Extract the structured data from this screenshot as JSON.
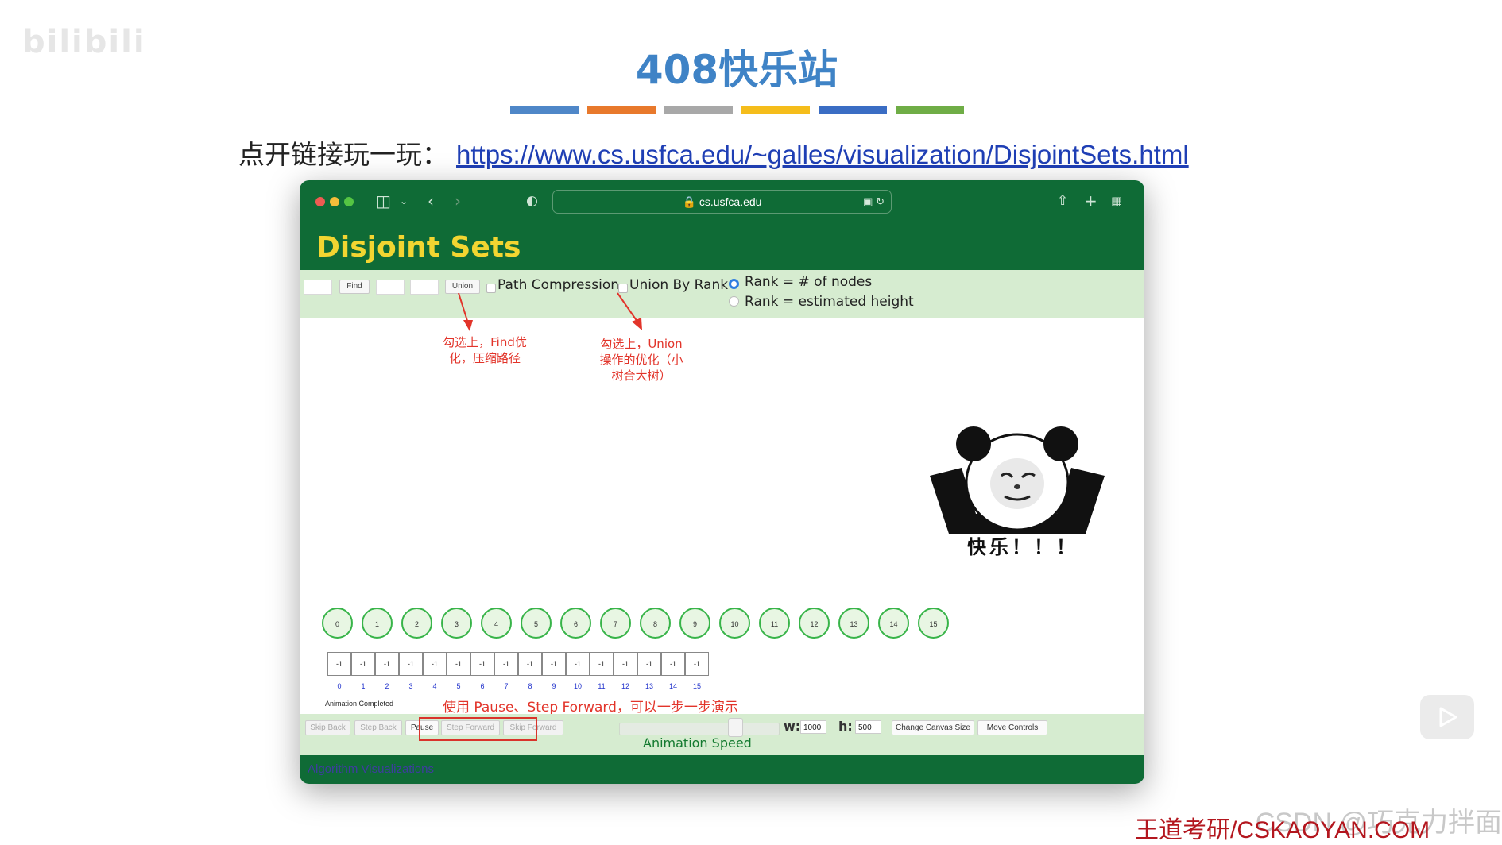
{
  "watermark": "bilibili",
  "slide": {
    "title": "408快乐站",
    "color_bars": [
      "#4f87c8",
      "#e8792c",
      "#a8a8a8",
      "#f5bd1b",
      "#3a6dc4",
      "#6fad46"
    ],
    "link_label": "点开链接玩一玩：",
    "link_url": "https://www.cs.usfca.edu/~galles/visualization/DisjointSets.html"
  },
  "browser": {
    "address": "cs.usfca.edu",
    "icons": [
      "sidebar-icon",
      "back-icon",
      "forward-icon",
      "shield-icon",
      "lock-icon",
      "translate-icon",
      "reload-icon",
      "share-icon",
      "new-tab-icon",
      "tabs-overview-icon"
    ]
  },
  "app": {
    "title": "Disjoint Sets",
    "controls": {
      "find_label": "Find",
      "union_label": "Union",
      "path_compression": "Path Compression",
      "union_by_rank": "Union By Rank",
      "rank_nodes": "Rank = # of nodes",
      "rank_height": "Rank = estimated height"
    },
    "annotations": {
      "find_note": "勾选上，Find优\n化，压缩路径",
      "union_note": "勾选上，Union\n操作的优化（小\n树合大树）",
      "bottom_note": "使用 Pause、Step Forward，可以一步一步演示"
    },
    "meme_caption": "快乐！！！",
    "nodes": [
      "0",
      "1",
      "2",
      "3",
      "4",
      "5",
      "6",
      "7",
      "8",
      "9",
      "10",
      "11",
      "12",
      "13",
      "14",
      "15"
    ],
    "parent_values": [
      "-1",
      "-1",
      "-1",
      "-1",
      "-1",
      "-1",
      "-1",
      "-1",
      "-1",
      "-1",
      "-1",
      "-1",
      "-1",
      "-1",
      "-1",
      "-1"
    ],
    "indices": [
      "0",
      "1",
      "2",
      "3",
      "4",
      "5",
      "6",
      "7",
      "8",
      "9",
      "10",
      "11",
      "12",
      "13",
      "14",
      "15"
    ],
    "status": "Animation Completed",
    "bottom": {
      "skip_back": "Skip Back",
      "step_back": "Step Back",
      "pause": "Pause",
      "step_forward": "Step Forward",
      "skip_forward": "Skip Forward",
      "speed_label": "Animation Speed",
      "w_label": "w:",
      "w_value": "1000",
      "h_label": "h:",
      "h_value": "500",
      "change_canvas": "Change Canvas Size",
      "move_controls": "Move Controls"
    },
    "footer": "Algorithm Visualizations"
  },
  "corner": {
    "csdn": "CSDN @巧克力拌面",
    "wangdao": "王道考研/CSKAOYAN.COM"
  },
  "colors": {
    "app_green": "#0f6b36",
    "title_yellow": "#f2d531",
    "annotation_red": "#e2342a"
  }
}
